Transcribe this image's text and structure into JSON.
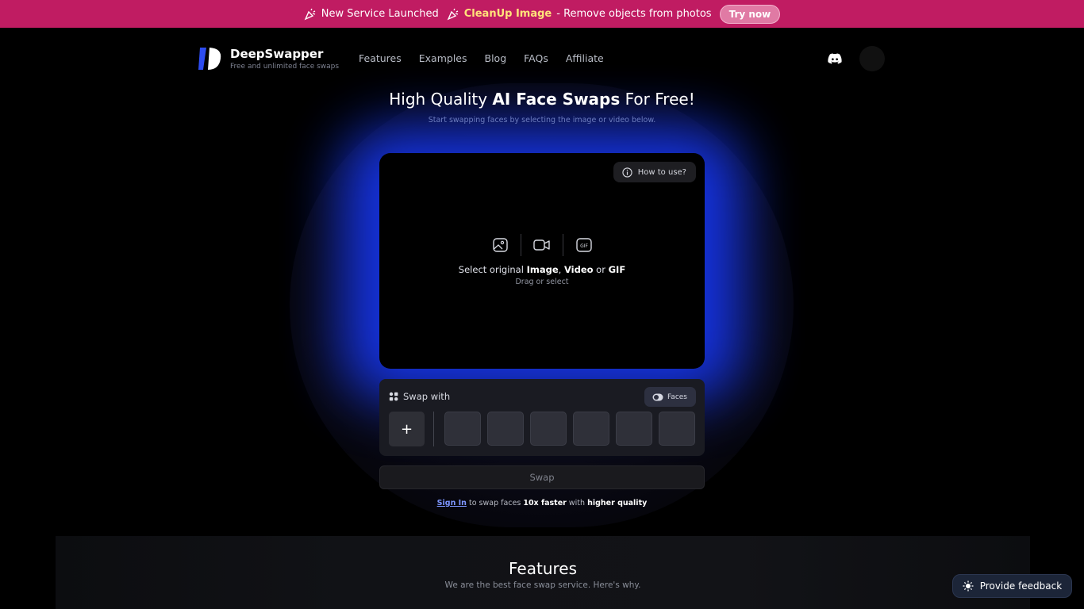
{
  "banner": {
    "prefix": "New Service Launched",
    "service": "CleanUp Image",
    "description": "- Remove objects from photos",
    "cta": "Try now",
    "accent": "#c01c62"
  },
  "header": {
    "brand": "DeepSwapper",
    "tagline": "Free and unlimited face swaps",
    "nav": [
      "Features",
      "Examples",
      "Blog",
      "FAQs",
      "Affiliate"
    ]
  },
  "hero": {
    "title_pre": "High Quality ",
    "title_bold": "AI Face Swaps",
    "title_post": " For Free!",
    "subtitle": "Start swapping faces by selecting the image or video below."
  },
  "upload": {
    "howto": "How to use?",
    "select_pre": "Select original ",
    "image": "Image",
    "comma": ", ",
    "video": "Video",
    "or": " or ",
    "gif": "GIF",
    "drag": "Drag or select",
    "icons": [
      "image-icon",
      "video-icon",
      "gif-icon"
    ]
  },
  "swap_with": {
    "label": "Swap with",
    "faces_button": "Faces",
    "add": "+",
    "slot_count": 6
  },
  "swap_button": "Swap",
  "signin": {
    "link": "Sign In",
    "text1": " to swap faces ",
    "bold1": "10x faster",
    "text2": " with ",
    "bold2": "higher quality"
  },
  "features": {
    "title": "Features",
    "subtitle": "We are the best face swap service. Here's why."
  },
  "feedback": "Provide feedback"
}
